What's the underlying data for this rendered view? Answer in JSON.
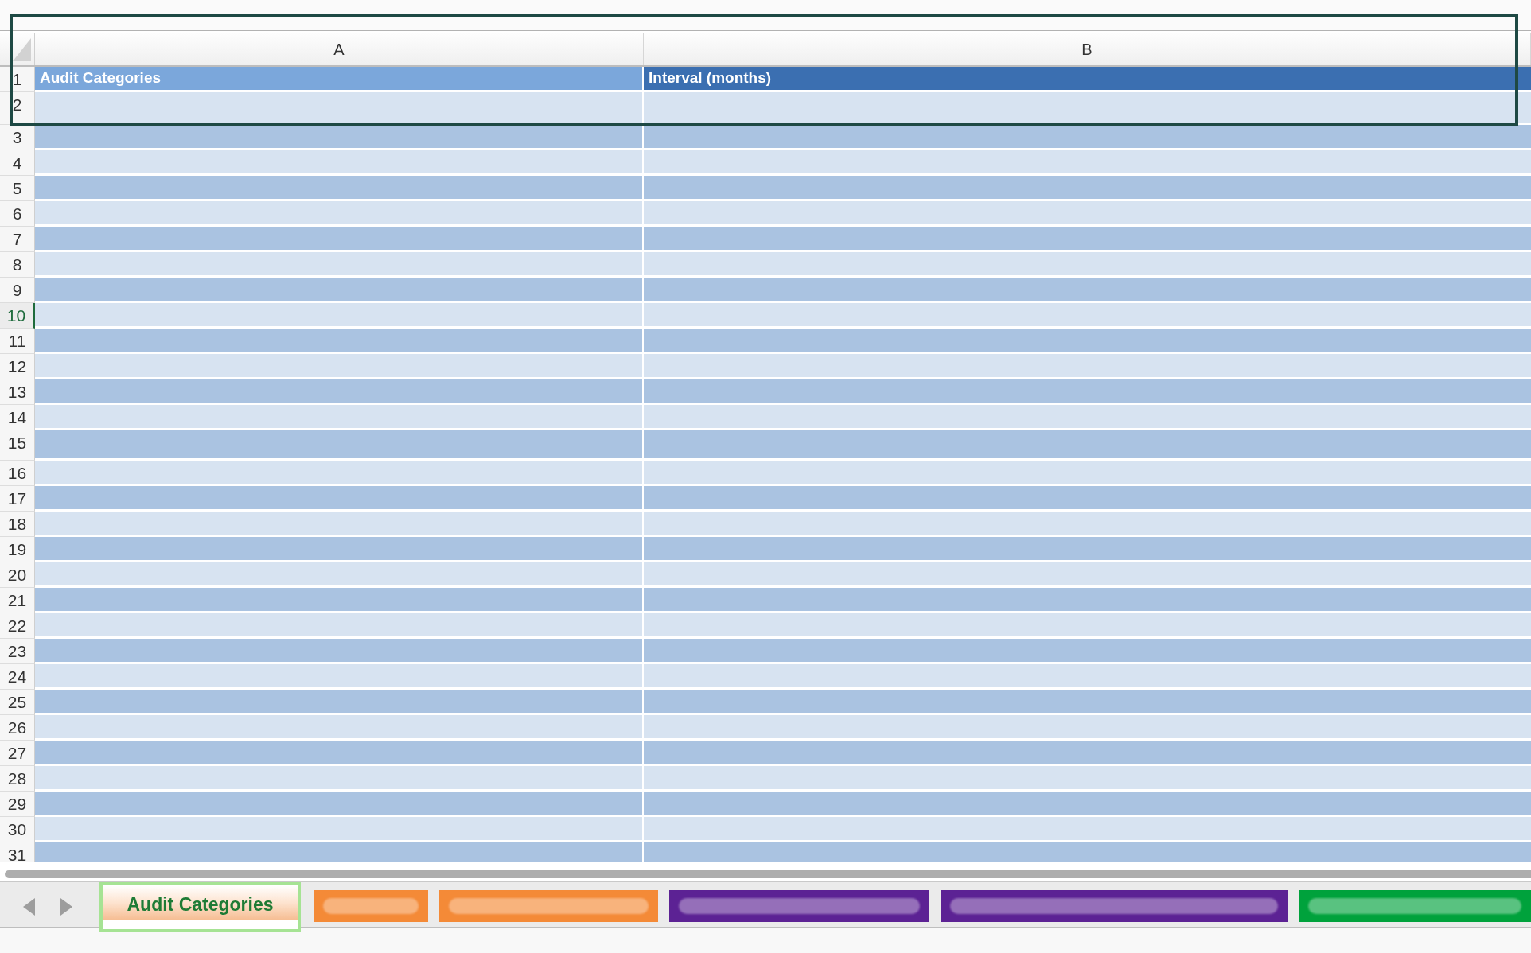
{
  "columns": [
    {
      "label": "A"
    },
    {
      "label": "B"
    }
  ],
  "rows": [
    {
      "number": "1",
      "selected": false,
      "cells": [
        {
          "text": "Audit Categories",
          "color": "#7ba7db"
        },
        {
          "text": "Interval (months)",
          "color": "#3b6fb1"
        }
      ]
    },
    {
      "number": "2",
      "selected": false
    },
    {
      "number": "3",
      "selected": false
    },
    {
      "number": "4",
      "selected": false
    },
    {
      "number": "5",
      "selected": false
    },
    {
      "number": "6",
      "selected": false
    },
    {
      "number": "7",
      "selected": false
    },
    {
      "number": "8",
      "selected": false
    },
    {
      "number": "9",
      "selected": false
    },
    {
      "number": "10",
      "selected": true
    },
    {
      "number": "11",
      "selected": false
    },
    {
      "number": "12",
      "selected": false
    },
    {
      "number": "13",
      "selected": false
    },
    {
      "number": "14",
      "selected": false
    },
    {
      "number": "15",
      "selected": false
    },
    {
      "number": "16",
      "selected": false
    },
    {
      "number": "17",
      "selected": false
    },
    {
      "number": "18",
      "selected": false
    },
    {
      "number": "19",
      "selected": false
    },
    {
      "number": "20",
      "selected": false
    },
    {
      "number": "21",
      "selected": false
    },
    {
      "number": "22",
      "selected": false
    },
    {
      "number": "23",
      "selected": false
    },
    {
      "number": "24",
      "selected": false
    },
    {
      "number": "25",
      "selected": false
    },
    {
      "number": "26",
      "selected": false
    },
    {
      "number": "27",
      "selected": false
    },
    {
      "number": "28",
      "selected": false
    },
    {
      "number": "29",
      "selected": false
    },
    {
      "number": "30",
      "selected": false
    },
    {
      "number": "31",
      "selected": false
    }
  ],
  "sheet_tabs": [
    {
      "label": "Audit Categories",
      "selected": true
    },
    {
      "selected": false,
      "color": "#f48a37"
    },
    {
      "selected": false,
      "color": "#f48a37"
    },
    {
      "selected": false,
      "color": "#5c2294"
    },
    {
      "selected": false,
      "color": "#5c2294"
    },
    {
      "selected": false,
      "color": "#00a23c"
    }
  ]
}
